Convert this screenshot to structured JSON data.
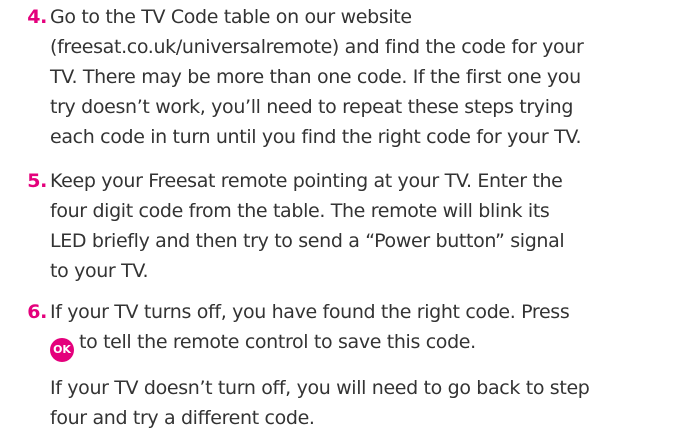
{
  "steps": [
    {
      "number": "4.",
      "lines": [
        "Go to the TV Code table on our website",
        "(freesat.co.uk/universalremote) and find the code for your",
        "TV. There may be more than one code. If the first one you",
        "try doesn’t work, you’ll need to repeat these steps trying",
        "each code in turn until you find the right code for your TV."
      ]
    },
    {
      "number": "5.",
      "lines": [
        "Keep your Freesat remote pointing at your TV. Enter the",
        "four digit code from the table. The remote will blink its",
        "LED briefly and then try to send a “Power button” signal",
        "to your TV."
      ]
    },
    {
      "number": "6.",
      "lines": [
        "If your TV turns off, you have found the right code. Press"
      ],
      "button_line_rest": "to tell the remote control to save this code.",
      "after_lines": [
        "If your TV doesn’t turn off, you will need to go back to step",
        "four and try a different code."
      ]
    }
  ],
  "ok_button": {
    "label": "OK",
    "icon": "ok-button-icon",
    "color": "#e4007c"
  },
  "accent_color": "#e4007c",
  "text_color": "#333333"
}
